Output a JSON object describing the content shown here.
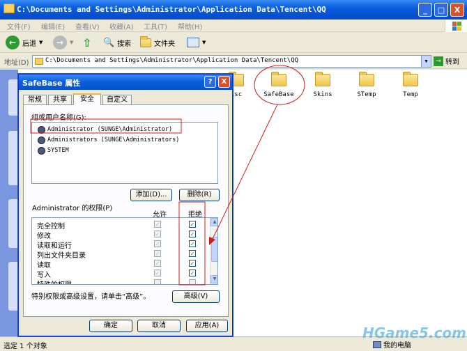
{
  "window": {
    "path": "C:\\Documents and Settings\\Administrator\\Application Data\\Tencent\\QQ",
    "min": "_",
    "max": "□",
    "close": "X"
  },
  "menu": [
    "文件(F)",
    "编辑(E)",
    "查看(V)",
    "收藏(A)",
    "工具(T)",
    "帮助(H)"
  ],
  "toolbar": {
    "back": "后退",
    "search": "搜索",
    "folders": "文件夹"
  },
  "address": {
    "label": "地址(D)",
    "value": "C:\\Documents and Settings\\Administrator\\Application Data\\Tencent\\QQ",
    "go": "转到"
  },
  "folders": [
    "isc",
    "SafeBase",
    "Skins",
    "STemp",
    "Temp"
  ],
  "status": {
    "left": "选定 1 个对象",
    "right": "我的电脑"
  },
  "watermark": "HGame5.com",
  "dialog": {
    "title": "SafeBase 属性",
    "help": "?",
    "close": "X",
    "tabs": [
      "常规",
      "共享",
      "安全",
      "自定义"
    ],
    "active_tab": "安全",
    "group_label": "组或用户名称(G):",
    "users": [
      "Administrator (SUNGE\\Administrator)",
      "Administrators (SUNGE\\Administrators)",
      "SYSTEM"
    ],
    "selected_user": "Administrator (SUNGE\\Administrator)",
    "add_button": "添加(D)...",
    "remove_button": "删除(R)",
    "perm_label": "Administrator 的权限(P)",
    "allow_header": "允许",
    "deny_header": "拒绝",
    "permissions": [
      {
        "name": "完全控制",
        "allow": true,
        "deny": true
      },
      {
        "name": "修改",
        "allow": true,
        "deny": true
      },
      {
        "name": "读取和运行",
        "allow": true,
        "deny": true
      },
      {
        "name": "列出文件夹目录",
        "allow": true,
        "deny": true
      },
      {
        "name": "读取",
        "allow": true,
        "deny": true
      },
      {
        "name": "写入",
        "allow": true,
        "deny": true
      },
      {
        "name": "特殊的权限",
        "allow": false,
        "deny": false
      }
    ],
    "advanced_text": "特别权限或高级设置，请单击“高级”。",
    "advanced_button": "高级(V)",
    "ok": "确定",
    "cancel": "取消",
    "apply": "应用(A)"
  },
  "colors": {
    "xp_blue": "#0a5ddc",
    "annotation_red": "#d01c1c",
    "check_green": "#1a8c1a"
  }
}
